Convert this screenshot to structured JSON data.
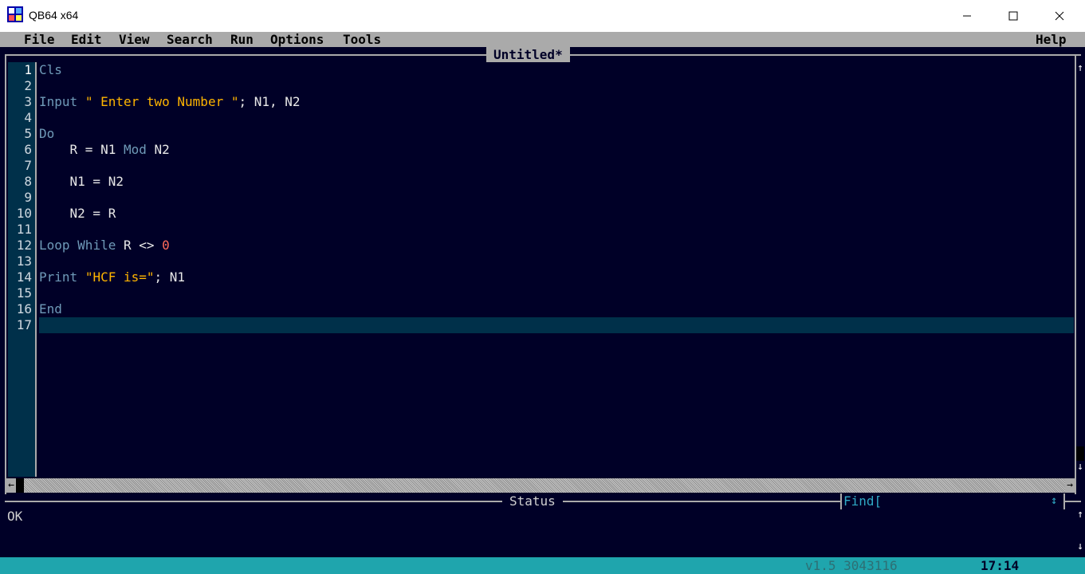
{
  "window": {
    "title": "QB64 x64",
    "icon": "qb64-app-icon",
    "controls": [
      "minimize-icon",
      "maximize-icon",
      "close-icon"
    ]
  },
  "menu": {
    "items": [
      "File",
      "Edit",
      "View",
      "Search",
      "Run",
      "Options",
      "Tools"
    ],
    "help": "Help"
  },
  "editor": {
    "tab_title": "Untitled*",
    "line_numbers": [
      "1",
      "2",
      "3",
      "4",
      "5",
      "6",
      "7",
      "8",
      "9",
      "10",
      "11",
      "12",
      "13",
      "14",
      "15",
      "16",
      "17"
    ],
    "current_line": 17,
    "lines": [
      [
        {
          "t": "Cls",
          "c": "kw"
        }
      ],
      [],
      [
        {
          "t": "Input",
          "c": "kw"
        },
        {
          "t": " ",
          "c": "id"
        },
        {
          "t": "\" Enter two Number \"",
          "c": "str"
        },
        {
          "t": "; N1, N2",
          "c": "id"
        }
      ],
      [],
      [
        {
          "t": "Do",
          "c": "kw"
        }
      ],
      [
        {
          "t": "    R = N1 ",
          "c": "id"
        },
        {
          "t": "Mod",
          "c": "kw"
        },
        {
          "t": " N2",
          "c": "id"
        }
      ],
      [],
      [
        {
          "t": "    N1 = N2",
          "c": "id"
        }
      ],
      [],
      [
        {
          "t": "    N2 = R",
          "c": "id"
        }
      ],
      [],
      [
        {
          "t": "Loop",
          "c": "kw"
        },
        {
          "t": " ",
          "c": "id"
        },
        {
          "t": "While",
          "c": "kw"
        },
        {
          "t": " R <> ",
          "c": "id"
        },
        {
          "t": "0",
          "c": "num"
        }
      ],
      [],
      [
        {
          "t": "Print",
          "c": "kw"
        },
        {
          "t": " ",
          "c": "id"
        },
        {
          "t": "\"HCF is=\"",
          "c": "str"
        },
        {
          "t": "; N1",
          "c": "id"
        }
      ],
      [],
      [
        {
          "t": "End",
          "c": "kw"
        }
      ],
      []
    ]
  },
  "colors": {
    "background": "#000027",
    "keyword": "#6f9ab8",
    "string": "#ffb500",
    "number": "#ff6b5a",
    "current_line": "#00304a",
    "status_bar": "#1fa5ad"
  },
  "status": {
    "title": "Status",
    "message": "OK",
    "find_label": "Find[",
    "find_icon": "up-down-arrow-icon"
  },
  "bottom_bar": {
    "version": "v1.5 3043116",
    "cursor": "17:14"
  }
}
